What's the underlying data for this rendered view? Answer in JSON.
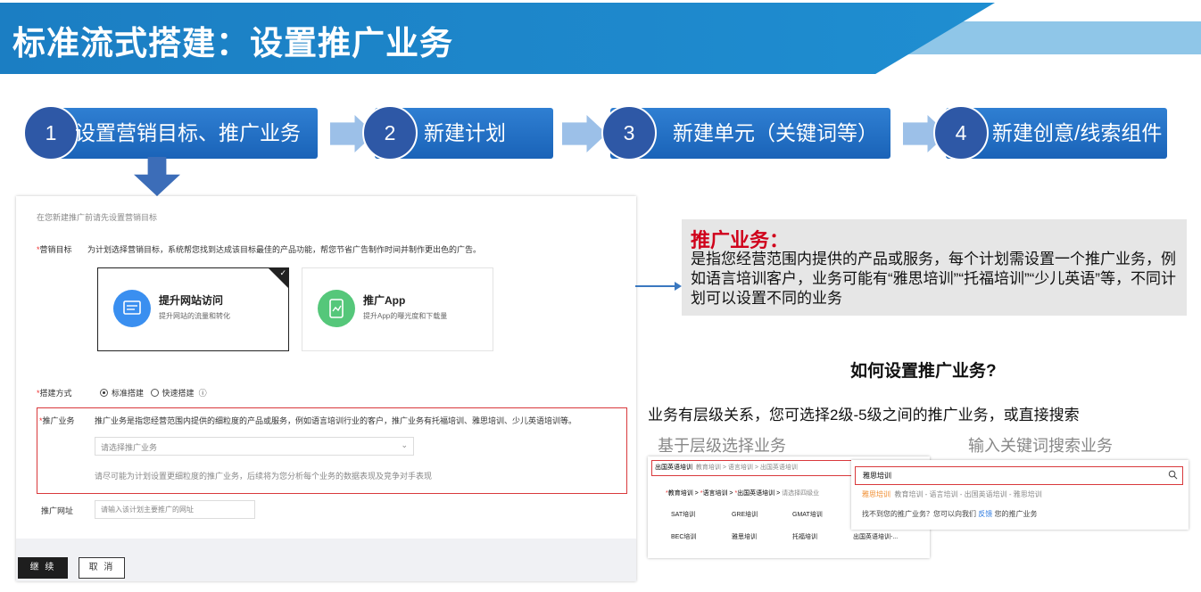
{
  "header": {
    "title": "标准流式搭建：设置推广业务"
  },
  "steps": [
    {
      "num": "1",
      "label": "设置营销目标、推广业务"
    },
    {
      "num": "2",
      "label": "新建计划"
    },
    {
      "num": "3",
      "label": "新建单元（关键词等）"
    },
    {
      "num": "4",
      "label": "新建创意/线索组件"
    }
  ],
  "form": {
    "hint": "在您新建推广前请先设置营销目标",
    "goal_label": "营销目标",
    "goal_desc": "为计划选择营销目标，系统帮您找到达成该目标最佳的产品功能，帮您节省广告制作时间并制作更出色的广告。",
    "goals": [
      {
        "title": "提升网站访问",
        "desc": "提升网站的流量和转化"
      },
      {
        "title": "推广App",
        "desc": "提升App的曝光度和下载量"
      }
    ],
    "build_label": "搭建方式",
    "build_options": [
      "标准搭建",
      "快速搭建"
    ],
    "business_label": "推广业务",
    "business_desc": "推广业务是指您经营范围内提供的细粒度的产品或服务，例如语言培训行业的客户，推广业务有托福培训、雅思培训、少儿英语培训等。",
    "business_placeholder": "请选择推广业务",
    "business_note": "请尽可能为计划设置更细粒度的推广业务，后续将为您分析每个业务的数据表现及竞争对手表现",
    "url_label": "推广网址",
    "url_placeholder": "请输入该计划主要推广的网址",
    "continue_label": "继 续",
    "cancel_label": "取 消"
  },
  "info": {
    "heading": "推广业务：",
    "text": "是指您经营范围内提供的产品或服务，每个计划需设置一个推广业务，例如语言培训客户，业务可能有“雅思培训”“托福培训”“少儿英语”等，不同计划可以设置不同的业务"
  },
  "how": {
    "title": "如何设置推广业务?",
    "levels_text": "业务有层级关系，您可选择2级-5级之间的推广业务，或直接搜索",
    "hier_caption": "基于层级选择业务",
    "search_caption": "输入关键词搜索业务"
  },
  "hierarchy": {
    "crumb_selected": "出国英语培训",
    "crumb_path": "教育培训 > 语言培训 > 出国英语培训",
    "levels": [
      "教育培训",
      "语言培训",
      "出国英语培训"
    ],
    "level_placeholder": "请选择四级业",
    "tags": [
      "SAT培训",
      "GRE培训",
      "GMAT培训",
      "BEC培训",
      "雅思培训",
      "托福培训",
      "出国英语培训-..."
    ]
  },
  "search": {
    "query": "雅思培训",
    "suggestion_highlight": "雅思培训",
    "suggestion_path": "教育培训 - 语言培训 - 出国英语培训 - 雅思培训",
    "notfound_prefix": "找不到您的推广业务？您可以向我们",
    "notfound_link": "反馈",
    "notfound_suffix": "您的推广业务"
  },
  "colors": {
    "brand_blue": "#1f8ed1",
    "step_blue": "#2f7fd2",
    "alert_red": "#d0021b"
  }
}
